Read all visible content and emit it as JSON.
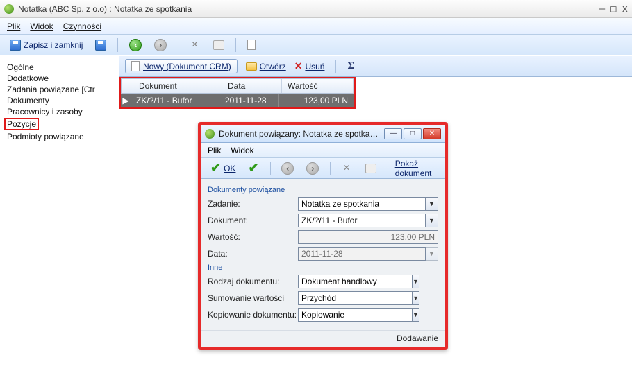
{
  "window": {
    "title": "Notatka (ABC Sp. z o.o) : Notatka ze spotkania",
    "controls": {
      "min": "—",
      "max": "□",
      "close": "x"
    }
  },
  "menubar": {
    "plik": "Plik",
    "widok": "Widok",
    "czynnosci": "Czynności"
  },
  "main_toolbar": {
    "save_close": "Zapisz i zamknij"
  },
  "sidebar": {
    "items": {
      "ogolne": "Ogólne",
      "dodatkowe": "Dodatkowe",
      "zadania": "Zadania powiązane [Ctr",
      "dokumenty": "Dokumenty",
      "pracownicy": "Pracownicy i zasoby",
      "pozycje": "Pozycje",
      "podmioty": "Podmioty powiązane"
    }
  },
  "content_toolbar": {
    "nowy": "Nowy (Dokument CRM)",
    "otworz": "Otwórz",
    "usun": "Usuń"
  },
  "table": {
    "headers": {
      "dokument": "Dokument",
      "data": "Data",
      "wartosc": "Wartość"
    },
    "row": {
      "marker": "▶",
      "dokument": "ZK/?/11 - Bufor",
      "data": "2011-11-28",
      "wartosc": "123,00 PLN"
    }
  },
  "dialog": {
    "title": "Dokument powiązany: Notatka ze spotkan...",
    "menu": {
      "plik": "Plik",
      "widok": "Widok"
    },
    "toolbar": {
      "ok": "OK",
      "show": "Pokaż dokument"
    },
    "sections": {
      "dokumenty": "Dokumenty powiązane",
      "inne": "Inne"
    },
    "labels": {
      "zadanie": "Zadanie:",
      "dokument": "Dokument:",
      "wartosc": "Wartość:",
      "data": "Data:",
      "rodzaj": "Rodzaj dokumentu:",
      "sumowanie": "Sumowanie wartości",
      "kopiowanie": "Kopiowanie dokumentu:"
    },
    "values": {
      "zadanie": "Notatka ze spotkania",
      "dokument": "ZK/?/11 - Bufor",
      "wartosc": "123,00 PLN",
      "data": "2011-11-28",
      "rodzaj": "Dokument handlowy",
      "sumowanie": "Przychód",
      "kopiowanie": "Kopiowanie"
    },
    "footer": "Dodawanie"
  }
}
